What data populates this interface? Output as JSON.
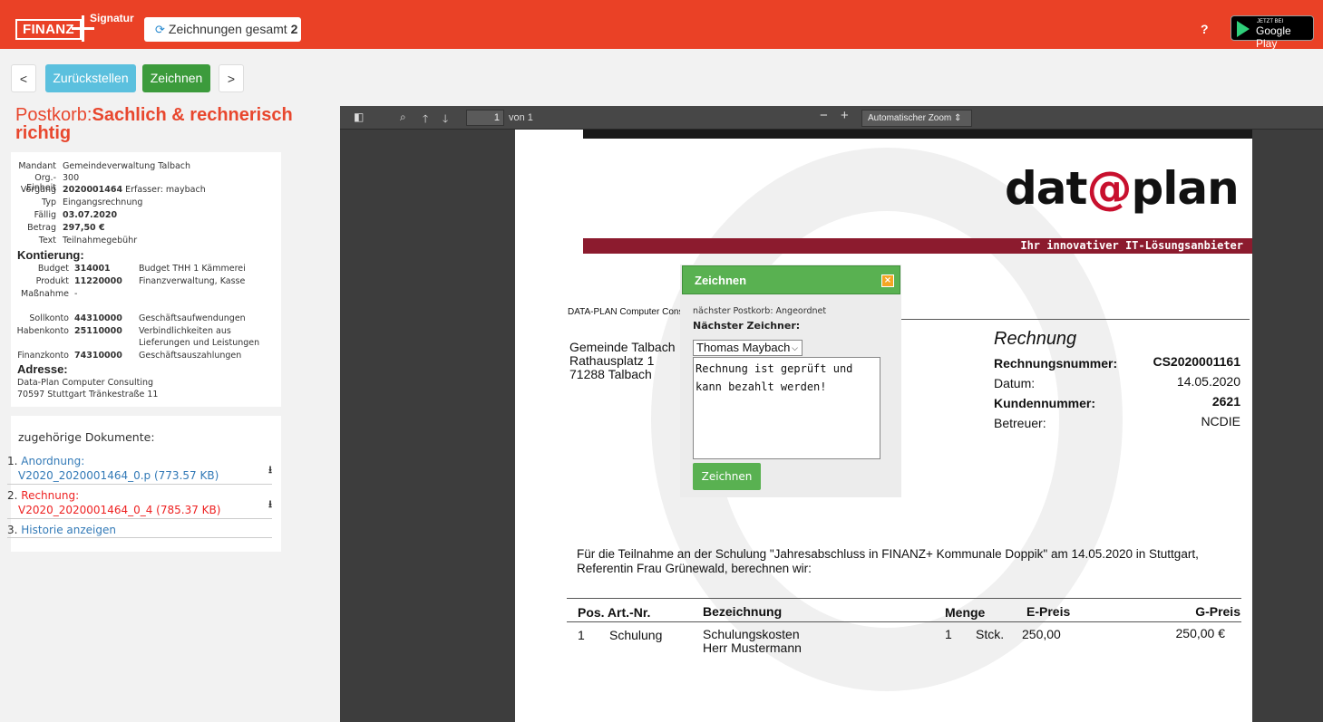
{
  "header": {
    "logo_main": "FINANZ",
    "logo_sup": "Signatur",
    "count_label": "Zeichnungen gesamt",
    "count_value": "2",
    "help": "?",
    "store_small": "JETZT BEI",
    "store_big": "Google Play"
  },
  "toolbar": {
    "prev": "<",
    "reset": "Zurückstellen",
    "sign": "Zeichnen",
    "next": ">"
  },
  "postkorb": {
    "prefix": "Postkorb:",
    "name": "Sachlich & rechnerisch richtig"
  },
  "info": {
    "mandant_label": "Mandant",
    "mandant": "Gemeindeverwaltung Talbach",
    "orgeinheit_label": "Org.-Einheit",
    "orgeinheit": "300",
    "vorgang_label": "Vorgang",
    "vorgang": "2020001464",
    "erfasser": "Erfasser: maybach",
    "typ_label": "Typ",
    "typ": "Eingangsrechnung",
    "faellig_label": "Fällig",
    "faellig": "03.07.2020",
    "betrag_label": "Betrag",
    "betrag": "297,50 €",
    "text_label": "Text",
    "text": "Teilnahmegebühr",
    "kontierung_heading": "Kontierung:",
    "budget_label": "Budget",
    "budget": "314001",
    "budget_desc": "Budget THH 1 Kämmerei",
    "produkt_label": "Produkt",
    "produkt": "11220000",
    "produkt_desc": "Finanzverwaltung, Kasse",
    "massnahme_label": "Maßnahme",
    "massnahme": "-",
    "sollkonto_label": "Sollkonto",
    "sollkonto": "44310000",
    "sollkonto_desc": "Geschäftsaufwendungen",
    "habenkonto_label": "Habenkonto",
    "habenkonto": "25110000",
    "habenkonto_desc1": "Verbindlichkeiten aus",
    "habenkonto_desc2": "Lieferungen und Leistungen",
    "finanzkonto_label": "Finanzkonto",
    "finanzkonto": "74310000",
    "finanzkonto_desc": "Geschäftsauszahlungen",
    "adresse_heading": "Adresse:",
    "adresse1": "Data-Plan Computer Consulting",
    "adresse2": "70597 Stuttgart Tränkestraße 11"
  },
  "docs": {
    "heading": "zugehörige Dokumente:",
    "items": [
      {
        "num": "1.",
        "title": "Anordnung:",
        "file": "V2020_2020001464_0.p (773.57 KB)"
      },
      {
        "num": "2.",
        "title": "Rechnung:",
        "file": "V2020_2020001464_0_4 (785.37 KB)"
      },
      {
        "num": "3.",
        "title": "Historie anzeigen"
      }
    ]
  },
  "viewer": {
    "page": "1",
    "page_of": "von 1",
    "zoom": "Automatischer Zoom"
  },
  "document": {
    "logo_left": "dat",
    "logo_at": "@",
    "logo_right": "plan",
    "tagline": "Ihr innovativer IT-Lösungsanbieter",
    "sender_line": "DATA-PLAN Computer Cons",
    "recipient1": "Gemeinde Talbach",
    "recipient2": "Rathausplatz 1",
    "recipient3": "71288 Talbach",
    "heading": "Rechnung",
    "rnr_label": "Rechnungsnummer:",
    "rnr": "CS2020001161",
    "datum_label": "Datum:",
    "datum": "14.05.2020",
    "knr_label": "Kundennummer:",
    "knr": "2621",
    "betreuer_label": "Betreuer:",
    "betreuer": "NCDIE",
    "intro1": "Für die Teilnahme an der Schulung \"Jahresabschluss in FINANZ+ Kommunale Doppik\" am 14.05.2020 in Stuttgart,",
    "intro2": "Referentin Frau Grünewald, berechnen wir:",
    "col_pos": "Pos. Art.-Nr.",
    "col_bez": "Bezeichnung",
    "col_menge": "Menge",
    "col_epreis": "E-Preis",
    "col_gpreis": "G-Preis",
    "row_pos": "1",
    "row_art": "Schulung",
    "row_bez1": "Schulungskosten",
    "row_bez2": "Herr Mustermann",
    "row_menge": "1",
    "row_unit": "Stck.",
    "row_epreis": "250,00",
    "row_gpreis": "250,00 €"
  },
  "dialog": {
    "title": "Zeichnen",
    "close": "×",
    "next_postkorb": "nächster Postkorb: Angeordnet",
    "next_signer_label": "Nächster Zeichner:",
    "signer": "Thomas Maybach",
    "comment": "Rechnung ist geprüft und kann bezahlt werden!",
    "submit": "Zeichnen"
  }
}
